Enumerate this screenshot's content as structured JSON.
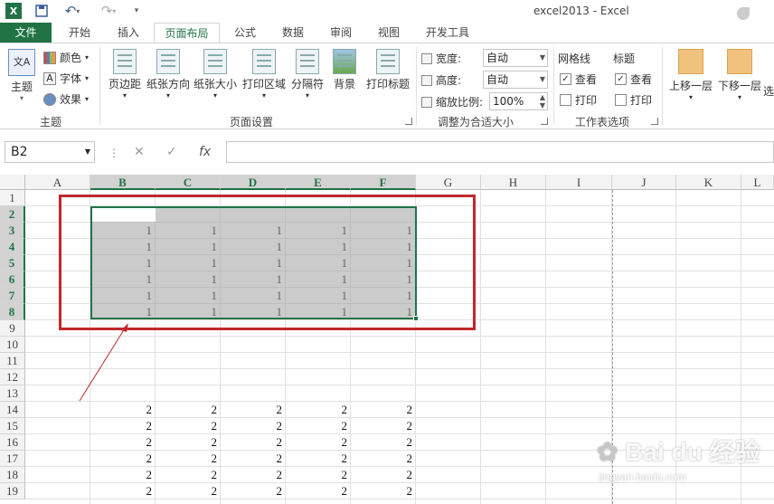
{
  "window": {
    "title": "excel2013 - Excel"
  },
  "quick_access": {
    "excel_icon": "excel-logo-icon",
    "save_icon": "save-icon",
    "undo_icon": "undo-icon",
    "redo_icon": "redo-icon",
    "customize_icon": "customize-qat-icon"
  },
  "tabs": [
    "文件",
    "开始",
    "插入",
    "页面布局",
    "公式",
    "数据",
    "审阅",
    "视图",
    "开发工具"
  ],
  "active_tab": "页面布局",
  "ribbon": {
    "themes": {
      "theme_btn": "主题",
      "colors": "颜色",
      "fonts": "字体",
      "effects": "效果",
      "group": "主题"
    },
    "page_setup": {
      "margins": "页边距",
      "orientation": "纸张方向",
      "size": "纸张大小",
      "print_area": "打印区域",
      "breaks": "分隔符",
      "background": "背景",
      "print_titles": "打印标题",
      "group": "页面设置"
    },
    "scale_to_fit": {
      "width_label": "宽度:",
      "width_value": "自动",
      "height_label": "高度:",
      "height_value": "自动",
      "scale_label": "缩放比例:",
      "scale_value": "100%",
      "group": "调整为合适大小"
    },
    "sheet_options": {
      "gridlines": "网格线",
      "headings": "标题",
      "view1": "查看",
      "print1": "打印",
      "view2": "查看",
      "print2": "打印",
      "group": "工作表选项"
    },
    "arrange": {
      "bring_forward": "上移一层",
      "send_backward": "下移一层",
      "selection": "选"
    }
  },
  "formula_bar": {
    "name_box": "B2",
    "cancel": "✕",
    "enter": "✓",
    "fx": "fx",
    "formula": ""
  },
  "sheet": {
    "columns": [
      "A",
      "B",
      "C",
      "D",
      "E",
      "F",
      "G",
      "H",
      "I",
      "J",
      "K",
      "L"
    ],
    "rows": [
      "1",
      "2",
      "3",
      "4",
      "5",
      "6",
      "7",
      "8",
      "9",
      "10",
      "11",
      "12",
      "13",
      "14",
      "15",
      "16",
      "17",
      "18",
      "19"
    ],
    "block1": {
      "value": "1"
    },
    "block2": {
      "value": "2"
    }
  },
  "watermark": {
    "brand": "Bai du 经验",
    "url": "jingyan.baidu.com"
  },
  "colors": {
    "accent": "#217346",
    "selection": "#c7c7c7",
    "highlight_box": "#c0282d"
  }
}
